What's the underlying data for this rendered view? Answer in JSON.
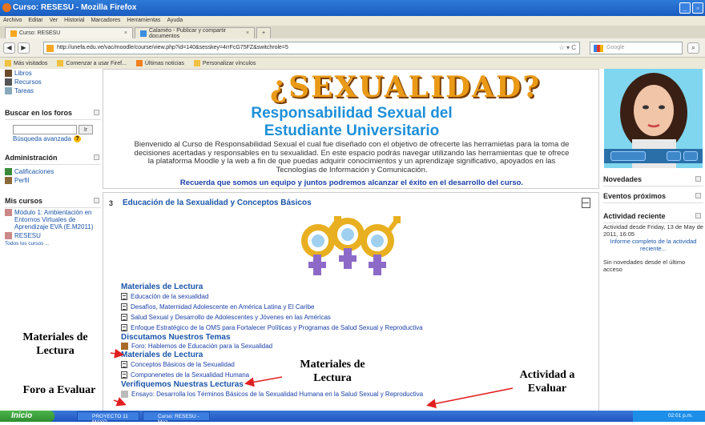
{
  "window": {
    "title": "Curso: RESESU - Mozilla Firefox"
  },
  "menu": [
    "Archivo",
    "Editar",
    "Ver",
    "Historial",
    "Marcadores",
    "Herramientas",
    "Ayuda"
  ],
  "tabs": [
    {
      "label": "Curso: RESESU",
      "active": true
    },
    {
      "label": "Calaméo - Publicar y compartir documentos",
      "active": false
    }
  ],
  "nav": {
    "url": "http://unefa.edu.ve/vac/moodle/course/view.php?id=140&sesskey=4rrFcG75FZ&switchrole=5",
    "search_placeholder": "Google"
  },
  "bookmarks": [
    "Más visitados",
    "Comenzar a usar Firef...",
    "Últimas noticias",
    "Personalizar vínculos"
  ],
  "left": {
    "top_links": [
      "Libros",
      "Recursos",
      "Tareas"
    ],
    "forum_search": {
      "title": "Buscar en los foros",
      "button": "Ir",
      "advanced": "Búsqueda avanzada"
    },
    "admin": {
      "title": "Administración",
      "links": [
        "Calificaciones",
        "Perfil"
      ]
    },
    "courses": {
      "title": "Mis cursos",
      "items": [
        "Módulo 1: Ambientación en Entornos Virtuales de Aprendizaje EVA (E.M2011)",
        "RESESU"
      ],
      "all": "Todos los cursos ..."
    }
  },
  "banner": {
    "logo": "¿SEXUALIDAD?",
    "title_line1": "Responsabilidad Sexual del",
    "title_line2": "Estudiante Universitario",
    "description": "Bienvenido al Curso de Responsabilidad Sexual el cual fue diseñado con el objetivo de ofrecerte las herramietas para la toma de decisiones acertadas y responsables en tu sexualidad. En este espacio podrás navegar utilizando las herramientas que te ofrece la plataforma Moodle y la web a fin de que puedas adquirir conocimientos y un aprendizaje significativo, apoyados en las Tecnologías de Información y Comunicación.",
    "motto": "Recuerda que somos un equipo y juntos podremos alcanzar el éxito en el desarrollo del curso."
  },
  "section": {
    "number": "3",
    "title": "Educación de la Sexualidad y Conceptos Básicos",
    "h_materiales": "Materiales de Lectura",
    "readings": [
      "Educación de la sexualidad",
      "Desafíos, Maternidad Adolescente en América Latina y El Caribe",
      "Salud Sexual y Desarrollo de Adolescentes y Jóvenes en las Américas",
      "Enfoque Estratégico de la OMS para Fortalecer Políticas y Programas de Salud Sexual y Reproductiva"
    ],
    "h_discutamos": "Discutamos Nuestros Temas",
    "forum": "Foro: Hablemos de Educación para la Sexualidad",
    "h_materiales2": "Materiales de Lectura",
    "readings2": [
      "Conceptos Básicos de la Sexualidad",
      "Componenetes de la Sexualidad Humana"
    ],
    "h_verifiquemos": "Verifiquemos Nuestras Lecturas",
    "essay": "Ensayo: Desarrolla los Términos Básicos de la Sexualidad Humana en la Salud Sexual y Reproductiva"
  },
  "right": {
    "novedades": "Novedades",
    "eventos": "Eventos próximos",
    "actividad": "Actividad reciente",
    "activity_since": "Actividad desde Friday, 13 de May de 2011, 16:05",
    "report_link": "Informe completo de la actividad reciente...",
    "no_news": "Sin novedades desde el último acceso"
  },
  "annotations": {
    "materiales_left_1": "Materiales de",
    "materiales_left_2": "Lectura",
    "foro": "Foro a Evaluar",
    "materiales_center_1": "Materiales de",
    "materiales_center_2": "Lectura",
    "actividad_1": "Actividad a",
    "actividad_2": "Evaluar"
  },
  "taskbar": {
    "start": "Inicio",
    "items": [
      "PROYECTO 11 MAYO ...",
      "Curso: RESESU - Moz..."
    ],
    "clock": "02:01 p.m."
  },
  "colors": {
    "title_blue": "#1e8fd8",
    "link_blue": "#1a55a8",
    "arrow_red": "#e02020",
    "logo_orange": "#ea9a17"
  }
}
